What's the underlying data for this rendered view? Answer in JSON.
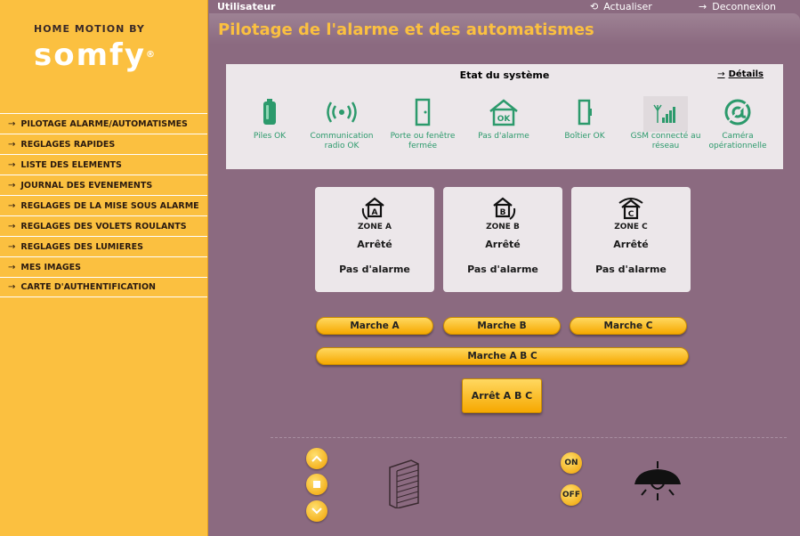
{
  "brand": {
    "line": "HOME MOTION BY",
    "logo": "somfy",
    "reg": "®"
  },
  "topbar": {
    "user": "Utilisateur",
    "refresh": "Actualiser",
    "logout": "Deconnexion"
  },
  "page": {
    "title": "Pilotage de l'alarme et des automatismes"
  },
  "nav": {
    "items": [
      "PILOTAGE ALARME/AUTOMATISMES",
      "REGLAGES RAPIDES",
      "LISTE DES ELEMENTS",
      "JOURNAL DES EVENEMENTS",
      "REGLAGES DE LA MISE SOUS ALARME",
      "REGLAGES DES VOLETS ROULANTS",
      "REGLAGES DES LUMIERES",
      "MES IMAGES",
      "CARTE D'AUTHENTIFICATION"
    ]
  },
  "status": {
    "title": "Etat du système",
    "details": "Détails",
    "items": [
      {
        "icon": "battery-icon",
        "caption": "Piles OK"
      },
      {
        "icon": "radio-signal-icon",
        "caption": "Communication radio OK"
      },
      {
        "icon": "door-icon",
        "caption": "Porte ou fenêtre fermée"
      },
      {
        "icon": "house-ok-icon",
        "caption": "Pas d'alarme"
      },
      {
        "icon": "box-icon",
        "caption": "Boîtier OK"
      },
      {
        "icon": "gsm-signal-icon",
        "caption": "GSM connecté au réseau"
      },
      {
        "icon": "camera-at-icon",
        "caption": "Caméra opérationnelle"
      }
    ],
    "icon_color": "#2c9a6c"
  },
  "zones": [
    {
      "letter": "A",
      "name": "ZONE A",
      "state": "Arrêté",
      "alarm": "Pas d'alarme"
    },
    {
      "letter": "B",
      "name": "ZONE B",
      "state": "Arrêté",
      "alarm": "Pas d'alarme"
    },
    {
      "letter": "C",
      "name": "ZONE C",
      "state": "Arrêté",
      "alarm": "Pas d'alarme"
    }
  ],
  "buttons": {
    "start_a": "Marche A",
    "start_b": "Marche B",
    "start_c": "Marche C",
    "start_abc": "Marche A B C",
    "stop_abc": "Arrêt A B C"
  },
  "controls": {
    "on": "ON",
    "off": "OFF"
  },
  "colors": {
    "accent": "#fbc040",
    "background": "#8b6a80",
    "panel": "#ece7ea"
  }
}
